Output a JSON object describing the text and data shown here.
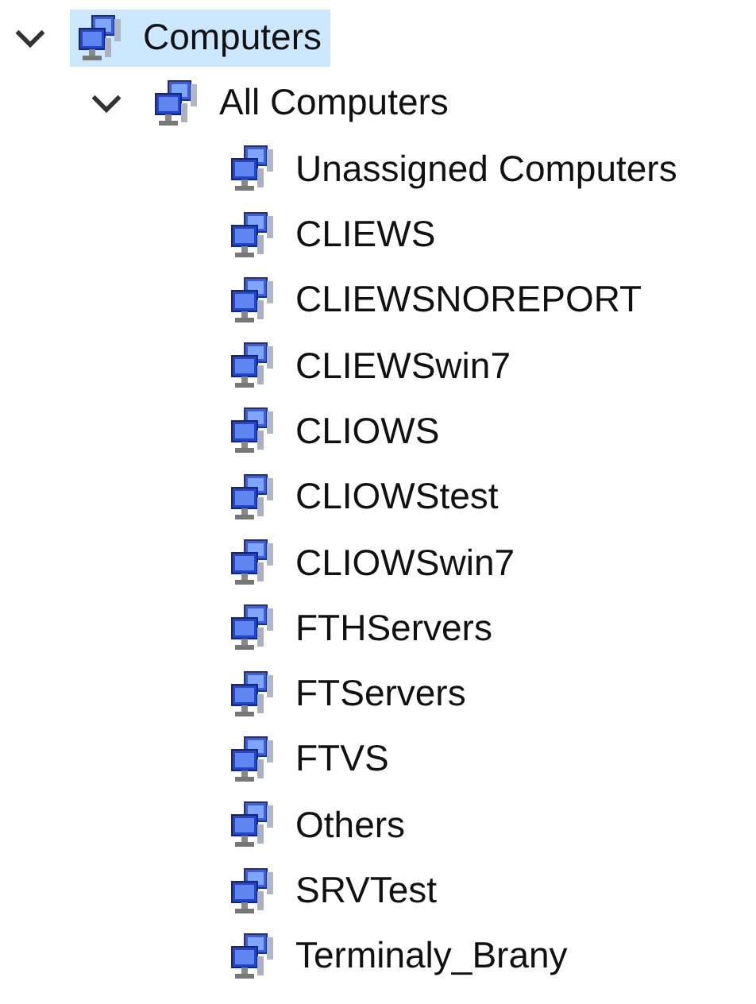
{
  "tree": [
    {
      "label": "Computers",
      "selected": true,
      "expanded": true,
      "children": [
        {
          "label": "All Computers",
          "selected": false,
          "expanded": true,
          "children": [
            {
              "label": "Unassigned Computers",
              "selected": false
            },
            {
              "label": "CLIEWS",
              "selected": false
            },
            {
              "label": "CLIEWSNOREPORT",
              "selected": false
            },
            {
              "label": "CLIEWSwin7",
              "selected": false
            },
            {
              "label": "CLIOWS",
              "selected": false
            },
            {
              "label": "CLIOWStest",
              "selected": false
            },
            {
              "label": "CLIOWSwin7",
              "selected": false
            },
            {
              "label": "FTHServers",
              "selected": false
            },
            {
              "label": "FTServers",
              "selected": false
            },
            {
              "label": "FTVS",
              "selected": false
            },
            {
              "label": "Others",
              "selected": false
            },
            {
              "label": "SRVTest",
              "selected": false
            },
            {
              "label": "Terminaly_Brany",
              "selected": false
            }
          ]
        }
      ]
    }
  ]
}
